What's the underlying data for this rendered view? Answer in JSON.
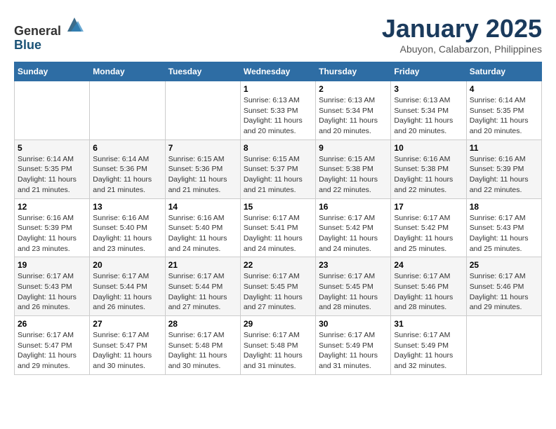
{
  "header": {
    "logo_line1": "General",
    "logo_line2": "Blue",
    "month": "January 2025",
    "location": "Abuyon, Calabarzon, Philippines"
  },
  "weekdays": [
    "Sunday",
    "Monday",
    "Tuesday",
    "Wednesday",
    "Thursday",
    "Friday",
    "Saturday"
  ],
  "weeks": [
    [
      {
        "day": "",
        "sunrise": "",
        "sunset": "",
        "daylight": ""
      },
      {
        "day": "",
        "sunrise": "",
        "sunset": "",
        "daylight": ""
      },
      {
        "day": "",
        "sunrise": "",
        "sunset": "",
        "daylight": ""
      },
      {
        "day": "1",
        "sunrise": "Sunrise: 6:13 AM",
        "sunset": "Sunset: 5:33 PM",
        "daylight": "Daylight: 11 hours and 20 minutes."
      },
      {
        "day": "2",
        "sunrise": "Sunrise: 6:13 AM",
        "sunset": "Sunset: 5:34 PM",
        "daylight": "Daylight: 11 hours and 20 minutes."
      },
      {
        "day": "3",
        "sunrise": "Sunrise: 6:13 AM",
        "sunset": "Sunset: 5:34 PM",
        "daylight": "Daylight: 11 hours and 20 minutes."
      },
      {
        "day": "4",
        "sunrise": "Sunrise: 6:14 AM",
        "sunset": "Sunset: 5:35 PM",
        "daylight": "Daylight: 11 hours and 20 minutes."
      }
    ],
    [
      {
        "day": "5",
        "sunrise": "Sunrise: 6:14 AM",
        "sunset": "Sunset: 5:35 PM",
        "daylight": "Daylight: 11 hours and 21 minutes."
      },
      {
        "day": "6",
        "sunrise": "Sunrise: 6:14 AM",
        "sunset": "Sunset: 5:36 PM",
        "daylight": "Daylight: 11 hours and 21 minutes."
      },
      {
        "day": "7",
        "sunrise": "Sunrise: 6:15 AM",
        "sunset": "Sunset: 5:36 PM",
        "daylight": "Daylight: 11 hours and 21 minutes."
      },
      {
        "day": "8",
        "sunrise": "Sunrise: 6:15 AM",
        "sunset": "Sunset: 5:37 PM",
        "daylight": "Daylight: 11 hours and 21 minutes."
      },
      {
        "day": "9",
        "sunrise": "Sunrise: 6:15 AM",
        "sunset": "Sunset: 5:38 PM",
        "daylight": "Daylight: 11 hours and 22 minutes."
      },
      {
        "day": "10",
        "sunrise": "Sunrise: 6:16 AM",
        "sunset": "Sunset: 5:38 PM",
        "daylight": "Daylight: 11 hours and 22 minutes."
      },
      {
        "day": "11",
        "sunrise": "Sunrise: 6:16 AM",
        "sunset": "Sunset: 5:39 PM",
        "daylight": "Daylight: 11 hours and 22 minutes."
      }
    ],
    [
      {
        "day": "12",
        "sunrise": "Sunrise: 6:16 AM",
        "sunset": "Sunset: 5:39 PM",
        "daylight": "Daylight: 11 hours and 23 minutes."
      },
      {
        "day": "13",
        "sunrise": "Sunrise: 6:16 AM",
        "sunset": "Sunset: 5:40 PM",
        "daylight": "Daylight: 11 hours and 23 minutes."
      },
      {
        "day": "14",
        "sunrise": "Sunrise: 6:16 AM",
        "sunset": "Sunset: 5:40 PM",
        "daylight": "Daylight: 11 hours and 24 minutes."
      },
      {
        "day": "15",
        "sunrise": "Sunrise: 6:17 AM",
        "sunset": "Sunset: 5:41 PM",
        "daylight": "Daylight: 11 hours and 24 minutes."
      },
      {
        "day": "16",
        "sunrise": "Sunrise: 6:17 AM",
        "sunset": "Sunset: 5:42 PM",
        "daylight": "Daylight: 11 hours and 24 minutes."
      },
      {
        "day": "17",
        "sunrise": "Sunrise: 6:17 AM",
        "sunset": "Sunset: 5:42 PM",
        "daylight": "Daylight: 11 hours and 25 minutes."
      },
      {
        "day": "18",
        "sunrise": "Sunrise: 6:17 AM",
        "sunset": "Sunset: 5:43 PM",
        "daylight": "Daylight: 11 hours and 25 minutes."
      }
    ],
    [
      {
        "day": "19",
        "sunrise": "Sunrise: 6:17 AM",
        "sunset": "Sunset: 5:43 PM",
        "daylight": "Daylight: 11 hours and 26 minutes."
      },
      {
        "day": "20",
        "sunrise": "Sunrise: 6:17 AM",
        "sunset": "Sunset: 5:44 PM",
        "daylight": "Daylight: 11 hours and 26 minutes."
      },
      {
        "day": "21",
        "sunrise": "Sunrise: 6:17 AM",
        "sunset": "Sunset: 5:44 PM",
        "daylight": "Daylight: 11 hours and 27 minutes."
      },
      {
        "day": "22",
        "sunrise": "Sunrise: 6:17 AM",
        "sunset": "Sunset: 5:45 PM",
        "daylight": "Daylight: 11 hours and 27 minutes."
      },
      {
        "day": "23",
        "sunrise": "Sunrise: 6:17 AM",
        "sunset": "Sunset: 5:45 PM",
        "daylight": "Daylight: 11 hours and 28 minutes."
      },
      {
        "day": "24",
        "sunrise": "Sunrise: 6:17 AM",
        "sunset": "Sunset: 5:46 PM",
        "daylight": "Daylight: 11 hours and 28 minutes."
      },
      {
        "day": "25",
        "sunrise": "Sunrise: 6:17 AM",
        "sunset": "Sunset: 5:46 PM",
        "daylight": "Daylight: 11 hours and 29 minutes."
      }
    ],
    [
      {
        "day": "26",
        "sunrise": "Sunrise: 6:17 AM",
        "sunset": "Sunset: 5:47 PM",
        "daylight": "Daylight: 11 hours and 29 minutes."
      },
      {
        "day": "27",
        "sunrise": "Sunrise: 6:17 AM",
        "sunset": "Sunset: 5:47 PM",
        "daylight": "Daylight: 11 hours and 30 minutes."
      },
      {
        "day": "28",
        "sunrise": "Sunrise: 6:17 AM",
        "sunset": "Sunset: 5:48 PM",
        "daylight": "Daylight: 11 hours and 30 minutes."
      },
      {
        "day": "29",
        "sunrise": "Sunrise: 6:17 AM",
        "sunset": "Sunset: 5:48 PM",
        "daylight": "Daylight: 11 hours and 31 minutes."
      },
      {
        "day": "30",
        "sunrise": "Sunrise: 6:17 AM",
        "sunset": "Sunset: 5:49 PM",
        "daylight": "Daylight: 11 hours and 31 minutes."
      },
      {
        "day": "31",
        "sunrise": "Sunrise: 6:17 AM",
        "sunset": "Sunset: 5:49 PM",
        "daylight": "Daylight: 11 hours and 32 minutes."
      },
      {
        "day": "",
        "sunrise": "",
        "sunset": "",
        "daylight": ""
      }
    ]
  ]
}
